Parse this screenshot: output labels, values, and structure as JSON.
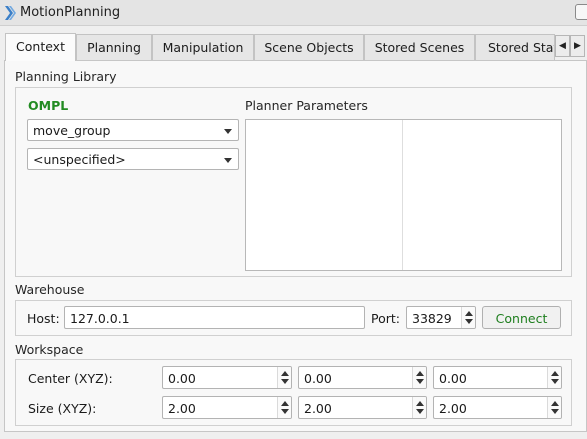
{
  "window": {
    "title": "MotionPlanning"
  },
  "tabs": [
    {
      "label": "Context",
      "active": true
    },
    {
      "label": "Planning",
      "active": false
    },
    {
      "label": "Manipulation",
      "active": false
    },
    {
      "label": "Scene Objects",
      "active": false
    },
    {
      "label": "Stored Scenes",
      "active": false
    },
    {
      "label": "Stored Stat",
      "active": false
    }
  ],
  "tab_scroll": {
    "left": "◀",
    "right": "▶"
  },
  "planning_library": {
    "section_label": "Planning Library",
    "library_name": "OMPL",
    "group_select": "move_group",
    "planner_select": "<unspecified>",
    "parameters_label": "Planner Parameters"
  },
  "warehouse": {
    "section_label": "Warehouse",
    "host_label": "Host:",
    "host_value": "127.0.0.1",
    "port_label": "Port:",
    "port_value": "33829",
    "connect_label": "Connect"
  },
  "workspace": {
    "section_label": "Workspace",
    "center_label": "Center (XYZ):",
    "center": [
      "0.00",
      "0.00",
      "0.00"
    ],
    "size_label": "Size (XYZ):",
    "size": [
      "2.00",
      "2.00",
      "2.00"
    ]
  },
  "colors": {
    "library_name": "#228b22",
    "connect_text": "#1e7e1e"
  }
}
